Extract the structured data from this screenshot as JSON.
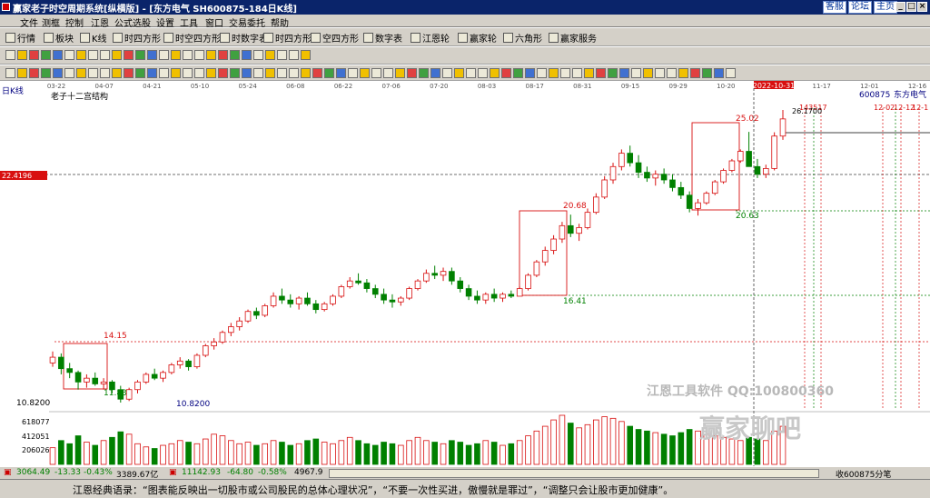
{
  "window": {
    "title": "赢家老子时空周期系统[纵横版] - [东方电气  SH600875-184日K线]",
    "links": [
      "客服",
      "论坛",
      "主页"
    ],
    "buttons": [
      "_",
      "□",
      "×"
    ]
  },
  "menu": [
    "文件",
    "测框",
    "控制",
    "江恩",
    "公式选股",
    "设置",
    "工具",
    "窗口",
    "交易委托",
    "帮助"
  ],
  "toolbar1": [
    "行情",
    "板块",
    "K线",
    "时四方形",
    "时空四方形",
    "时数字表",
    "时四方形",
    "空四方形",
    "数字表",
    "江恩轮",
    "赢家轮",
    "六角形",
    "赢家服务"
  ],
  "chart": {
    "period_label": "日K线",
    "indicator_name": "老子十二宫结构",
    "stock_code": "600875",
    "stock_name": "东方电气",
    "date_axis": [
      "03-22",
      "04-07",
      "04-21",
      "05-10",
      "05-24",
      "06-08",
      "06-22",
      "07-06",
      "07-20",
      "08-03",
      "08-17",
      "08-31",
      "09-15",
      "09-29",
      "10-20",
      "2022-10-31",
      "11-17",
      "12-01",
      "12-16"
    ],
    "left_price_tag": "22.4196",
    "price_labels": {
      "p1": "14.15",
      "p2": "11.83",
      "p3": "10.8200",
      "p4": "20.68",
      "p5": "16.41",
      "p6": "25.02",
      "p7": "20.63",
      "p8": "143517",
      "p9": "26.1700",
      "p10": "12-02",
      "p11": "12-12",
      "p12": "12-1"
    },
    "low_price_axis": "10.8200",
    "volume_labels": [
      "618077",
      "412051",
      "206026"
    ],
    "watermark_1": "江恩工具软件  QQ:100800360",
    "watermark_2": "赢家聊吧"
  },
  "chart_data": {
    "type": "candlestick",
    "x_start": "03-22",
    "x_end": "12-16",
    "price_range": [
      10.82,
      26.17
    ],
    "volume_range": [
      0,
      618077
    ],
    "candles": [
      [
        12.9,
        13.5,
        12.7,
        13.2
      ],
      [
        13.2,
        13.4,
        12.3,
        12.6
      ],
      [
        12.6,
        12.9,
        12.1,
        12.4
      ],
      [
        12.4,
        12.5,
        11.5,
        11.9
      ],
      [
        11.9,
        12.3,
        11.6,
        12.1
      ],
      [
        12.1,
        12.4,
        11.7,
        11.8
      ],
      [
        11.8,
        12.1,
        11.5,
        11.9
      ],
      [
        11.9,
        12.0,
        11.3,
        11.5
      ],
      [
        11.5,
        11.7,
        10.82,
        11.0
      ],
      [
        11.0,
        11.6,
        10.9,
        11.5
      ],
      [
        11.5,
        12.0,
        11.3,
        11.9
      ],
      [
        11.9,
        12.4,
        11.8,
        12.3
      ],
      [
        12.3,
        12.6,
        12.0,
        12.1
      ],
      [
        12.1,
        12.5,
        11.9,
        12.4
      ],
      [
        12.4,
        12.9,
        12.3,
        12.8
      ],
      [
        12.8,
        13.2,
        12.6,
        13.0
      ],
      [
        13.0,
        13.1,
        12.5,
        12.7
      ],
      [
        12.7,
        13.4,
        12.6,
        13.3
      ],
      [
        13.3,
        13.9,
        13.2,
        13.8
      ],
      [
        13.8,
        14.2,
        13.6,
        14.0
      ],
      [
        14.0,
        14.6,
        13.9,
        14.5
      ],
      [
        14.5,
        15.0,
        14.3,
        14.8
      ],
      [
        14.8,
        15.3,
        14.6,
        15.1
      ],
      [
        15.1,
        15.7,
        15.0,
        15.6
      ],
      [
        15.6,
        15.8,
        15.2,
        15.4
      ],
      [
        15.4,
        16.0,
        15.3,
        15.9
      ],
      [
        15.9,
        16.6,
        15.8,
        16.4
      ],
      [
        16.4,
        16.8,
        16.0,
        16.2
      ],
      [
        16.2,
        16.5,
        15.8,
        16.0
      ],
      [
        16.0,
        16.4,
        15.7,
        16.3
      ],
      [
        16.3,
        16.6,
        15.9,
        16.0
      ],
      [
        16.0,
        16.2,
        15.5,
        15.7
      ],
      [
        15.7,
        16.1,
        15.6,
        16.0
      ],
      [
        16.0,
        16.5,
        15.9,
        16.4
      ],
      [
        16.4,
        17.0,
        16.3,
        16.9
      ],
      [
        16.9,
        17.4,
        16.8,
        17.2
      ],
      [
        17.2,
        17.6,
        17.0,
        17.1
      ],
      [
        17.1,
        17.3,
        16.6,
        16.8
      ],
      [
        16.8,
        17.0,
        16.3,
        16.5
      ],
      [
        16.5,
        16.8,
        16.0,
        16.2
      ],
      [
        16.2,
        16.5,
        15.8,
        16.1
      ],
      [
        16.1,
        16.4,
        15.9,
        16.3
      ],
      [
        16.3,
        16.9,
        16.2,
        16.8
      ],
      [
        16.8,
        17.3,
        16.7,
        17.2
      ],
      [
        17.2,
        17.8,
        17.1,
        17.6
      ],
      [
        17.6,
        18.0,
        17.3,
        17.5
      ],
      [
        17.5,
        17.9,
        17.2,
        17.7
      ],
      [
        17.7,
        17.9,
        17.0,
        17.2
      ],
      [
        17.2,
        17.4,
        16.6,
        16.8
      ],
      [
        16.8,
        17.0,
        16.2,
        16.4
      ],
      [
        16.4,
        16.7,
        16.0,
        16.2
      ],
      [
        16.2,
        16.6,
        16.0,
        16.5
      ],
      [
        16.5,
        16.8,
        16.1,
        16.3
      ],
      [
        16.3,
        16.6,
        16.1,
        16.5
      ],
      [
        16.5,
        16.7,
        16.3,
        16.4
      ],
      [
        16.4,
        16.9,
        16.4,
        16.8
      ],
      [
        16.8,
        17.6,
        16.7,
        17.5
      ],
      [
        17.5,
        18.3,
        17.4,
        18.2
      ],
      [
        18.2,
        19.0,
        18.0,
        18.8
      ],
      [
        18.8,
        19.6,
        18.6,
        19.4
      ],
      [
        19.4,
        20.3,
        19.2,
        20.1
      ],
      [
        20.1,
        20.68,
        19.5,
        19.7
      ],
      [
        19.7,
        20.2,
        19.3,
        20.0
      ],
      [
        20.0,
        21.0,
        19.9,
        20.8
      ],
      [
        20.8,
        21.8,
        20.7,
        21.6
      ],
      [
        21.6,
        22.7,
        21.5,
        22.5
      ],
      [
        22.5,
        23.4,
        22.3,
        23.2
      ],
      [
        23.2,
        24.1,
        23.0,
        23.9
      ],
      [
        23.9,
        24.3,
        23.2,
        23.4
      ],
      [
        23.4,
        23.8,
        22.6,
        22.9
      ],
      [
        22.9,
        23.2,
        22.4,
        22.6
      ],
      [
        22.6,
        23.0,
        22.2,
        22.8
      ],
      [
        22.8,
        23.1,
        22.3,
        22.5
      ],
      [
        22.5,
        22.8,
        21.9,
        22.1
      ],
      [
        22.1,
        22.4,
        21.5,
        21.7
      ],
      [
        21.7,
        21.9,
        20.8,
        21.0
      ],
      [
        21.0,
        21.5,
        20.63,
        21.3
      ],
      [
        21.3,
        21.9,
        21.2,
        21.8
      ],
      [
        21.8,
        22.5,
        21.7,
        22.4
      ],
      [
        22.4,
        23.1,
        22.3,
        23.0
      ],
      [
        23.0,
        23.6,
        22.9,
        23.5
      ],
      [
        23.5,
        24.1,
        23.4,
        24.0
      ],
      [
        24.0,
        25.02,
        23.8,
        23.2
      ],
      [
        23.2,
        23.6,
        22.6,
        22.8
      ],
      [
        22.8,
        23.3,
        22.6,
        23.1
      ],
      [
        23.1,
        25.0,
        23.0,
        24.8
      ],
      [
        24.8,
        26.17,
        24.6,
        25.7
      ]
    ],
    "volumes": [
      210000,
      300000,
      260000,
      360000,
      280000,
      240000,
      300000,
      340000,
      410000,
      380000,
      260000,
      220000,
      200000,
      240000,
      260000,
      300000,
      280000,
      260000,
      320000,
      380000,
      360000,
      300000,
      260000,
      280000,
      240000,
      260000,
      300000,
      280000,
      240000,
      260000,
      300000,
      320000,
      280000,
      260000,
      300000,
      340000,
      300000,
      260000,
      240000,
      280000,
      260000,
      240000,
      300000,
      340000,
      300000,
      280000,
      260000,
      300000,
      280000,
      240000,
      260000,
      300000,
      280000,
      240000,
      260000,
      300000,
      360000,
      420000,
      480000,
      560000,
      618077,
      520000,
      460000,
      500000,
      560000,
      600000,
      580000,
      540000,
      480000,
      440000,
      420000,
      400000,
      380000,
      360000,
      400000,
      440000,
      420000,
      380000,
      360000,
      340000,
      320000,
      300000,
      340000,
      320000,
      300000,
      420000,
      480000
    ]
  },
  "status": {
    "sh_index": "3064.49",
    "sh_change": "-13.33",
    "sh_pct": "-0.43%",
    "sh_amount": "3389.67亿",
    "sz_index": "11142.93",
    "sz_change": "-64.80",
    "sz_pct": "-0.58%",
    "sz_amount": "4967.9",
    "right_text": "收600875分笔"
  },
  "quote": "江恩经典语录：“图表能反映出一切股市或公司股民的总体心理状况”，“不要一次性买进，傲慢就是罪过”，“调整只会让股市更加健康”。",
  "colors": {
    "up": "#d81010",
    "down": "#008000",
    "title_bg": "#0a246a",
    "panel_bg": "#d4d0c8",
    "box": "#d81010"
  }
}
